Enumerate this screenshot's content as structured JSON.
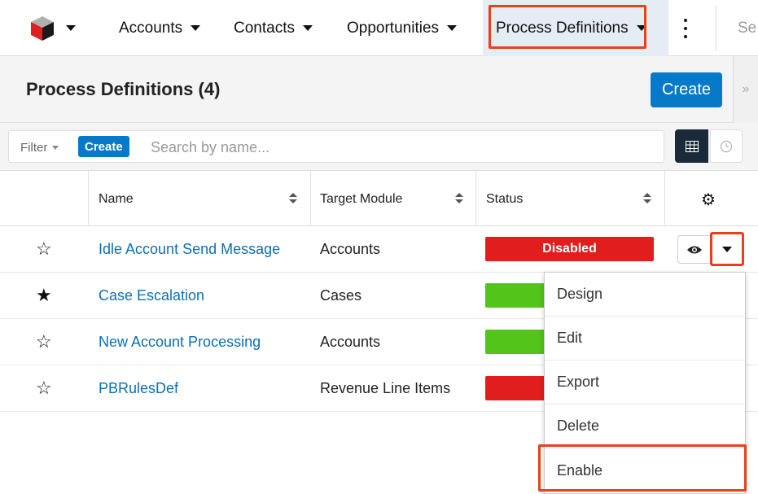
{
  "nav": {
    "items": [
      {
        "label": "Accounts"
      },
      {
        "label": "Contacts"
      },
      {
        "label": "Opportunities"
      },
      {
        "label": "Process Definitions"
      }
    ],
    "search_partial": "Se"
  },
  "header": {
    "title": "Process Definitions (4)",
    "create_label": "Create",
    "collapse_glyph": "»"
  },
  "filter": {
    "label": "Filter",
    "create_label": "Create",
    "placeholder": "Search by name..."
  },
  "table": {
    "columns": {
      "name": "Name",
      "target": "Target Module",
      "status": "Status"
    },
    "rows": [
      {
        "favorite": "☆",
        "name": "Idle Account Send Message",
        "target": "Accounts",
        "status": "Disabled",
        "status_color": "#e21d1d"
      },
      {
        "favorite": "★",
        "name": "Case Escalation",
        "target": "Cases",
        "status": "",
        "status_color": "#52c41a"
      },
      {
        "favorite": "☆",
        "name": "New Account Processing",
        "target": "Accounts",
        "status": "",
        "status_color": "#52c41a"
      },
      {
        "favorite": "☆",
        "name": "PBRulesDef",
        "target": "Revenue Line Items",
        "status": "",
        "status_color": "#e21d1d"
      }
    ]
  },
  "dropdown": {
    "items": [
      {
        "label": "Design"
      },
      {
        "label": "Edit"
      },
      {
        "label": "Export"
      },
      {
        "label": "Delete"
      },
      {
        "label": "Enable"
      }
    ]
  },
  "colors": {
    "accent": "#0679c8",
    "highlight": "#e8401c",
    "disabled": "#e21d1d",
    "active": "#52c41a"
  }
}
